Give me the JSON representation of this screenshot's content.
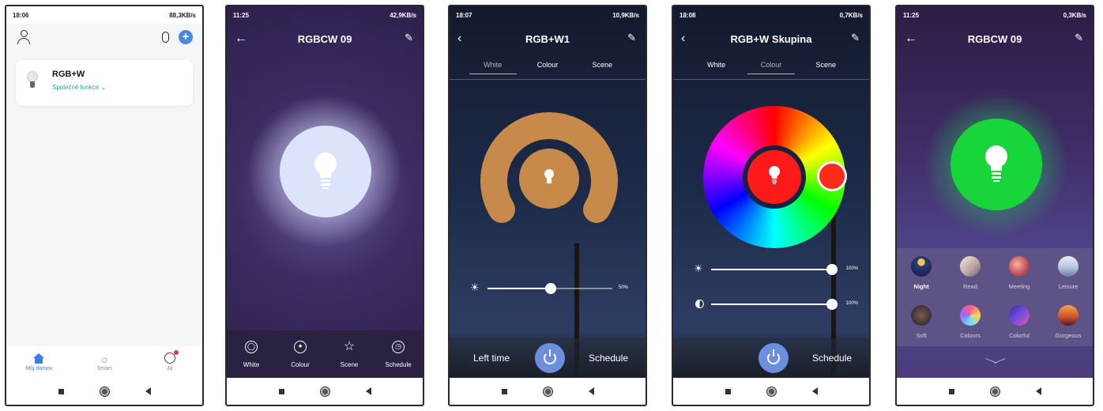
{
  "screens": [
    {
      "status": {
        "time": "18:06",
        "right": "88,3KB/s",
        "battery": "58"
      },
      "device": {
        "name": "RGB+W",
        "sub": "Společné funkce ⌄"
      },
      "tabs": [
        "Můj domov",
        "Smart",
        "Já"
      ]
    },
    {
      "status": {
        "time": "11:25",
        "right": "42,9KB/s",
        "battery": "71"
      },
      "title": "RGBCW 09",
      "buttons": [
        "White",
        "Colour",
        "Scene",
        "Schedule"
      ]
    },
    {
      "status": {
        "time": "18:07",
        "right": "10,9KB/s",
        "battery": "58"
      },
      "title": "RGB+W1",
      "tabs": [
        "White",
        "Colour",
        "Scene"
      ],
      "slider_value": "50%",
      "slider_level": 0.5,
      "left_label": "Left time",
      "right_label": "Schedule",
      "ring_color": "#c88a4a"
    },
    {
      "status": {
        "time": "18:08",
        "right": "0,7KB/s",
        "battery": "58"
      },
      "title": "RGB+W Skupina",
      "tabs": [
        "White",
        "Colour",
        "Scene"
      ],
      "brightness_value": "100%",
      "brightness_level": 1.0,
      "contrast_value": "100%",
      "contrast_level": 1.0,
      "right_label": "Schedule",
      "selected_color": "#ff1a1a"
    },
    {
      "status": {
        "time": "11:25",
        "right": "0,3KB/s",
        "battery": "71"
      },
      "title": "RGBCW 09",
      "scenes": [
        "Night",
        "Read",
        "Meeting",
        "Leisure",
        "Soft",
        "Colours",
        "Colorful",
        "Gorgeous"
      ],
      "bulb_color": "#18d63a"
    }
  ]
}
